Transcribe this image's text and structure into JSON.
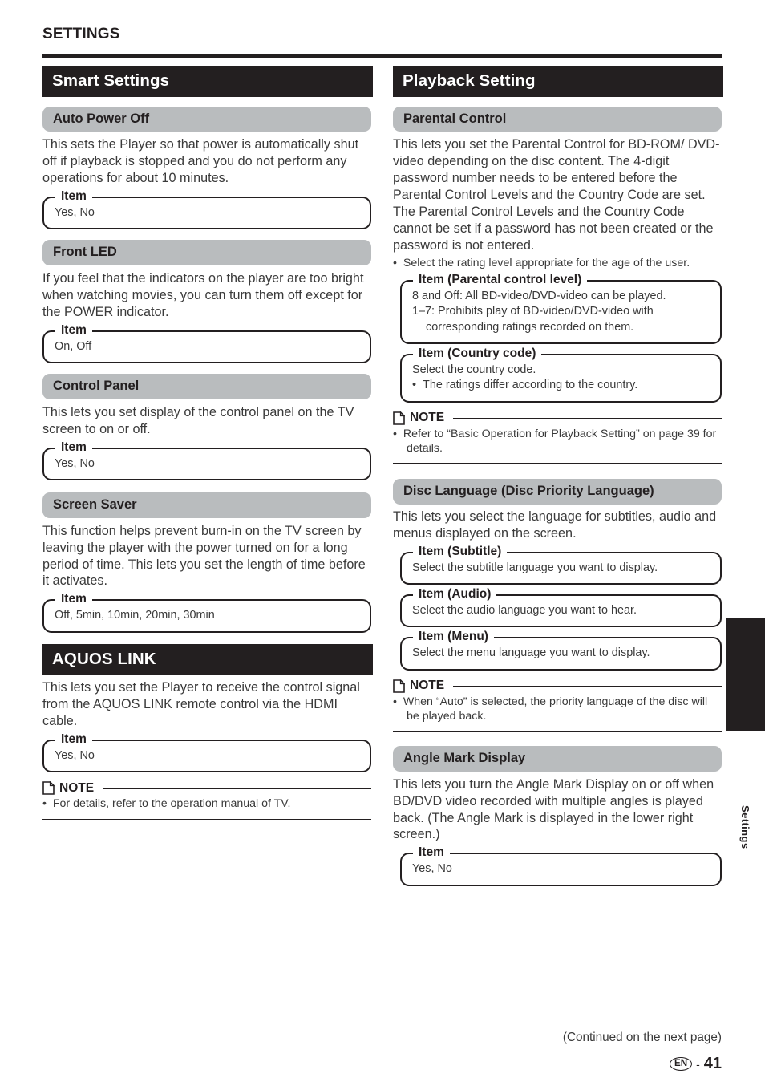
{
  "running_head": "SETTINGS",
  "left_column": {
    "sections": [
      {
        "bar_title": "Smart Settings",
        "subsections": [
          {
            "title": "Auto Power Off",
            "paragraph": "This sets the Player so that power is automatically shut off if playback is stopped and you do not perform any operations for about 10 minutes.",
            "item_legend": "Item",
            "item_value": "Yes, No"
          },
          {
            "title": "Front LED",
            "paragraph": "If you feel that the indicators on the player are too bright when watching movies, you can turn them off except for the POWER indicator.",
            "item_legend": "Item",
            "item_value": "On, Off"
          },
          {
            "title": "Control Panel",
            "paragraph": "This lets you set display of the control panel on the TV screen to on or off.",
            "item_legend": "Item",
            "item_value": "Yes, No"
          },
          {
            "title": "Screen Saver",
            "paragraph": "This function helps prevent burn-in on the TV screen by leaving the player with the power turned on for a long period of time. This lets you set the length of time before it activates.",
            "item_legend": "Item",
            "item_value": "Off, 5min, 10min, 20min, 30min"
          }
        ]
      },
      {
        "bar_title": "AQUOS LINK",
        "paragraph": "This lets you set the Player to receive the control signal from the AQUOS LINK remote control via the HDMI cable.",
        "item_legend": "Item",
        "item_value": "Yes, No",
        "note": {
          "label": "NOTE",
          "items": [
            "For details, refer to the operation manual of TV."
          ]
        }
      }
    ]
  },
  "right_column": {
    "bar_title": "Playback Setting",
    "subsections": [
      {
        "title": "Parental Control",
        "paragraph": "This lets you set the Parental Control for BD-ROM/ DVD-video depending on the disc content. The 4-digit password number needs to be entered before the Parental Control Levels and the Country Code are set. The Parental Control Levels and the Country Code cannot be set if a password has not been created or the password is not entered.",
        "body_bullets": [
          "Select the rating level appropriate for the age of the user."
        ],
        "item_boxes": [
          {
            "legend": "Item (Parental control level)",
            "lines": [
              {
                "style": "plain",
                "text": "8 and Off: All BD-video/DVD-video can be played."
              },
              {
                "style": "plain",
                "text": "1–7: Prohibits play of BD-video/DVD-video with"
              },
              {
                "style": "indent",
                "text": "corresponding ratings recorded on them."
              }
            ]
          },
          {
            "legend": "Item (Country code)",
            "lines": [
              {
                "style": "plain",
                "text": "Select the country code."
              },
              {
                "style": "bullet",
                "text": "The ratings differ according to the country."
              }
            ]
          }
        ],
        "note": {
          "label": "NOTE",
          "items": [
            "Refer to “Basic Operation for Playback Setting” on page 39 for details."
          ]
        }
      },
      {
        "title": "Disc Language (Disc Priority Language)",
        "paragraph": "This lets you select the language for subtitles, audio and menus displayed on the screen.",
        "item_boxes": [
          {
            "legend": "Item (Subtitle)",
            "lines": [
              {
                "style": "plain",
                "text": "Select the subtitle language you want to display."
              }
            ]
          },
          {
            "legend": "Item (Audio)",
            "lines": [
              {
                "style": "plain",
                "text": "Select the audio language you want to hear."
              }
            ]
          },
          {
            "legend": "Item (Menu)",
            "lines": [
              {
                "style": "plain",
                "text": "Select the menu language you want to display."
              }
            ]
          }
        ],
        "note": {
          "label": "NOTE",
          "items": [
            "When “Auto” is selected, the priority language of the disc will be played back."
          ]
        }
      },
      {
        "title": "Angle Mark Display",
        "paragraph": "This lets you turn the Angle Mark Display on or off when BD/DVD video recorded with multiple angles is played back. (The Angle Mark is displayed in the lower right screen.)",
        "item_legend": "Item",
        "item_value": "Yes, No"
      }
    ]
  },
  "side_tab": {
    "label": "Settings"
  },
  "footer": {
    "continued": "(Continued on the next page)",
    "language_code": "EN",
    "dash": "-",
    "page_number": "41"
  }
}
